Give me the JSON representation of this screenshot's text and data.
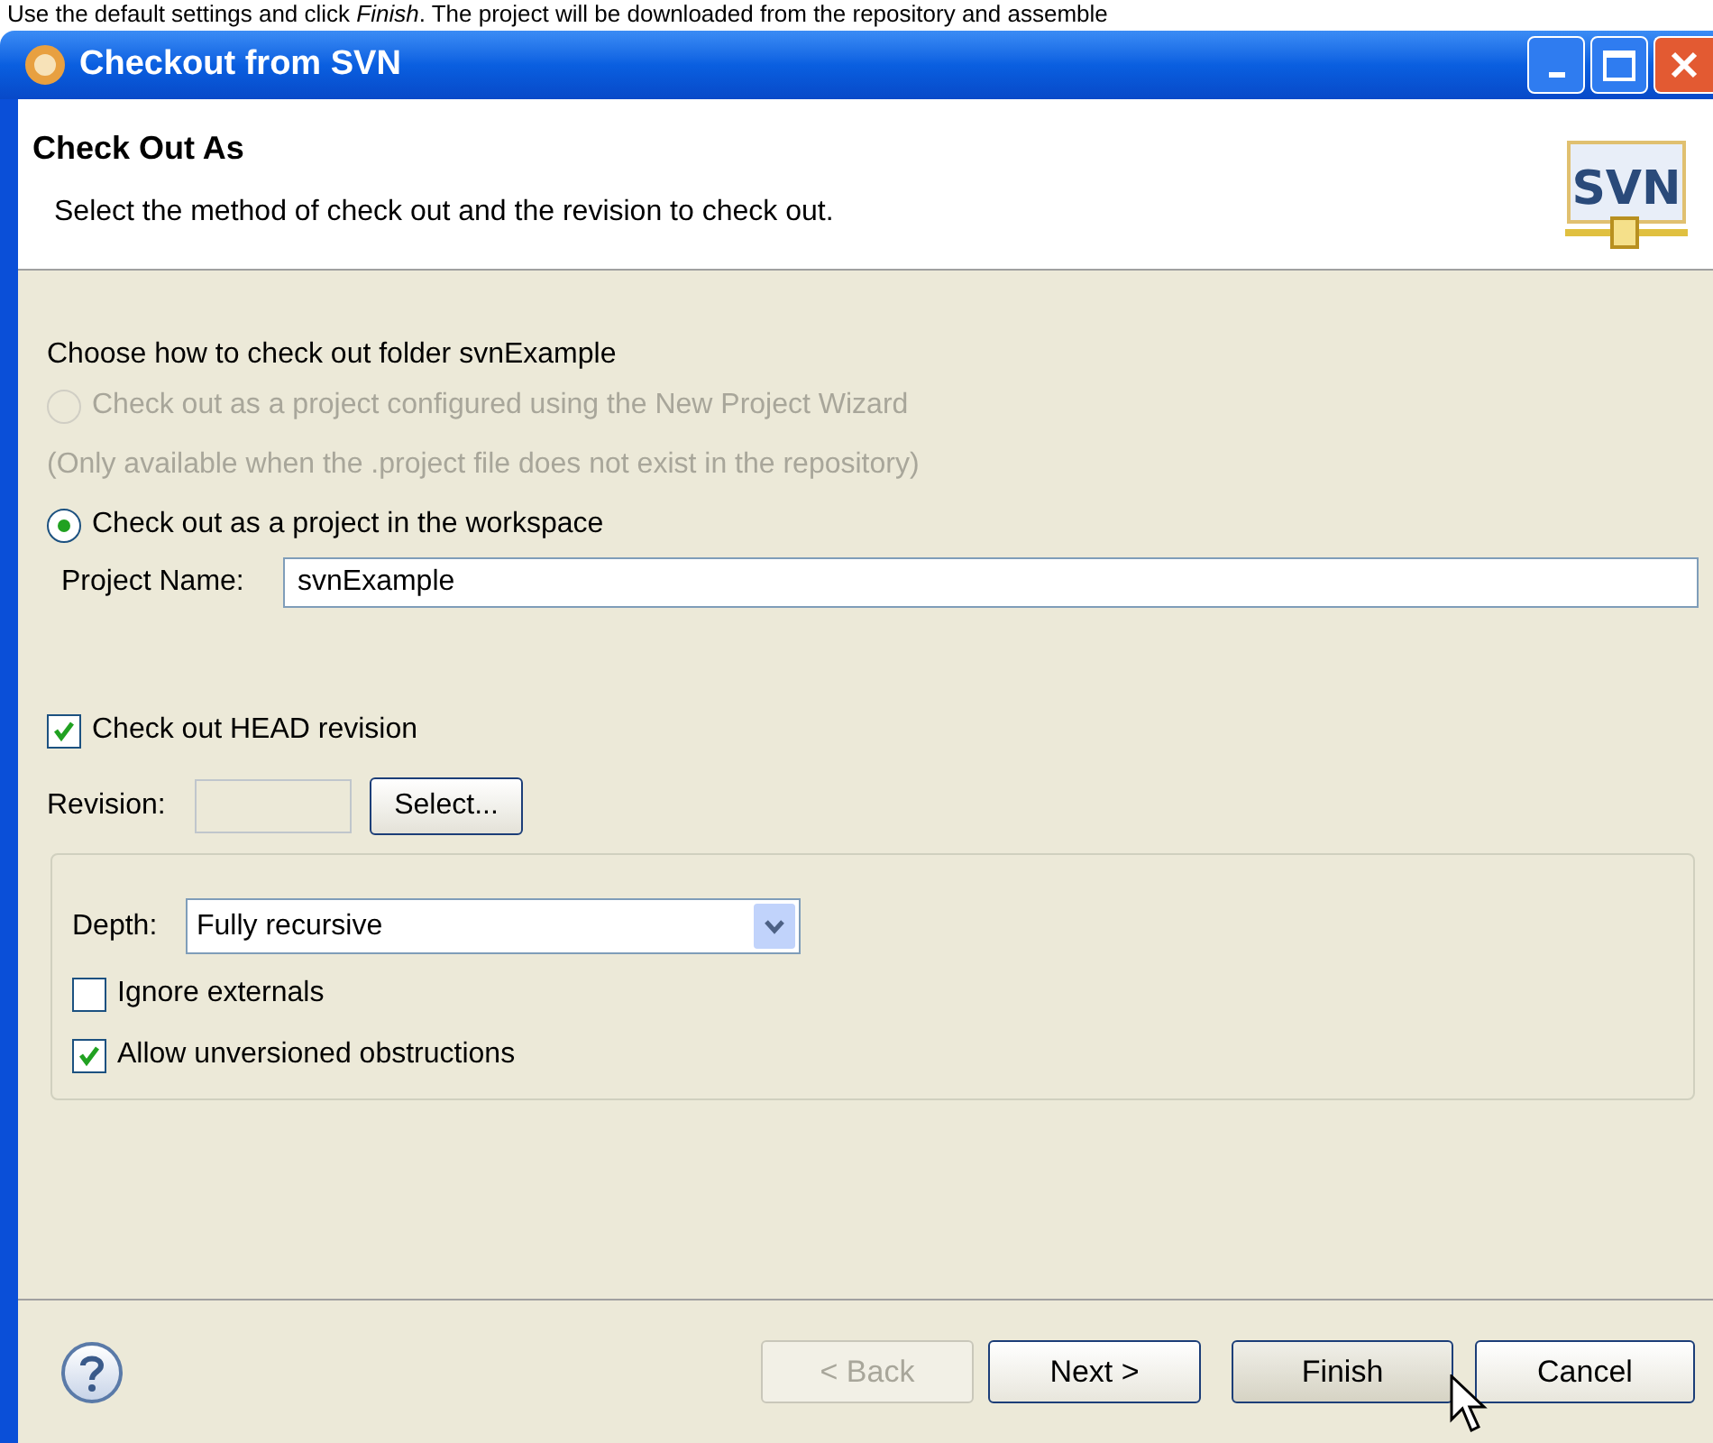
{
  "caption": "Use the default settings and click *Finish*. The project will be downloaded from the repository and assemble",
  "window": {
    "title": "Checkout from SVN"
  },
  "header": {
    "logo_text": "SVN",
    "title": "Check Out As",
    "description": "Select the method of check out and the revision to check out."
  },
  "method": {
    "label": "Choose how to check out folder svnExample",
    "options": [
      {
        "kind": "radio",
        "label": "Check out as a project configured using the New Project Wizard",
        "selected": false,
        "disabled": true
      },
      {
        "kind": "note",
        "label": "(Only available when the .project file does not exist in the repository)",
        "disabled": true
      },
      {
        "kind": "radio",
        "label": "Check out as a project in the workspace",
        "selected": true,
        "disabled": false
      }
    ],
    "project_name": {
      "label": "Project Name:",
      "value": "svnExample"
    }
  },
  "head_revision": {
    "label": "Check out HEAD revision",
    "checked": true
  },
  "revision": {
    "label": "Revision:",
    "button": "Select..."
  },
  "depth": {
    "label": "Depth:",
    "value": "Fully recursive"
  },
  "options": [
    {
      "label": "Ignore externals",
      "checked": false
    },
    {
      "label": "Allow unversioned obstructions",
      "checked": true
    }
  ],
  "buttons": [
    {
      "label": "< Back",
      "disabled": true
    },
    {
      "label": "Next >",
      "disabled": false
    },
    {
      "label": "Finish",
      "disabled": false,
      "hovered": true
    },
    {
      "label": "Cancel",
      "disabled": false
    }
  ]
}
